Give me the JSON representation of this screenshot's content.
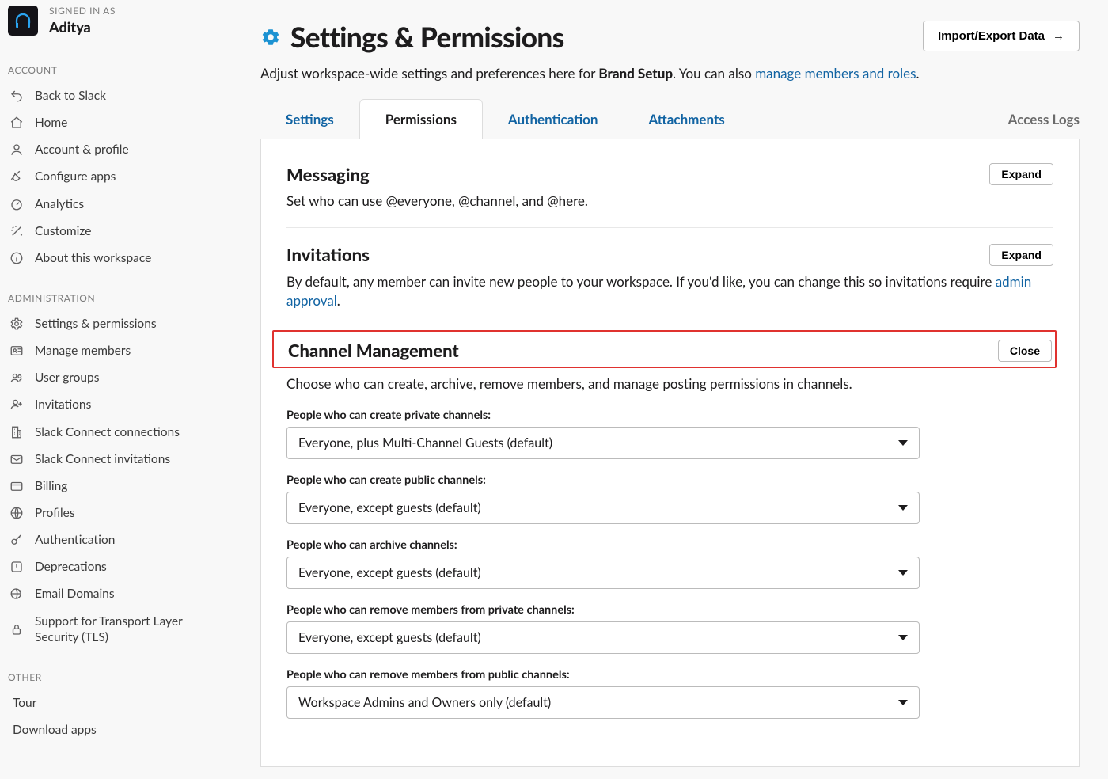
{
  "user": {
    "signed_in_as_label": "SIGNED IN AS",
    "name": "Aditya"
  },
  "sidebar": {
    "section_account": "ACCOUNT",
    "section_admin": "ADMINISTRATION",
    "section_other": "OTHER",
    "account_items": [
      {
        "id": "back",
        "label": "Back to Slack",
        "icon": "undo-icon"
      },
      {
        "id": "home",
        "label": "Home",
        "icon": "home-icon"
      },
      {
        "id": "profile",
        "label": "Account & profile",
        "icon": "person-icon"
      },
      {
        "id": "configure-apps",
        "label": "Configure apps",
        "icon": "plug-icon"
      },
      {
        "id": "analytics",
        "label": "Analytics",
        "icon": "gauge-icon"
      },
      {
        "id": "customize",
        "label": "Customize",
        "icon": "wand-icon"
      },
      {
        "id": "about",
        "label": "About this workspace",
        "icon": "info-icon"
      }
    ],
    "admin_items": [
      {
        "id": "settings-permissions",
        "label": "Settings & permissions",
        "icon": "gear-icon"
      },
      {
        "id": "manage-members",
        "label": "Manage members",
        "icon": "contact-card-icon"
      },
      {
        "id": "user-groups",
        "label": "User groups",
        "icon": "group-icon"
      },
      {
        "id": "invitations",
        "label": "Invitations",
        "icon": "person-plus-icon"
      },
      {
        "id": "slack-connect-connections",
        "label": "Slack Connect connections",
        "icon": "building-icon"
      },
      {
        "id": "slack-connect-invitations",
        "label": "Slack Connect invitations",
        "icon": "envelope-icon"
      },
      {
        "id": "billing",
        "label": "Billing",
        "icon": "card-icon"
      },
      {
        "id": "profiles",
        "label": "Profiles",
        "icon": "globe-icon"
      },
      {
        "id": "authentication",
        "label": "Authentication",
        "icon": "key-icon"
      },
      {
        "id": "deprecations",
        "label": "Deprecations",
        "icon": "warning-icon"
      },
      {
        "id": "email-domains",
        "label": "Email Domains",
        "icon": "globe-plus-icon"
      },
      {
        "id": "tls",
        "label": "Support for Transport Layer Security (TLS)",
        "icon": "lock-icon"
      }
    ],
    "other_items": [
      {
        "id": "tour",
        "label": "Tour"
      },
      {
        "id": "download",
        "label": "Download apps"
      }
    ]
  },
  "page": {
    "title": "Settings & Permissions",
    "import_button": "Import/Export Data",
    "subhead_pre": "Adjust workspace-wide settings and preferences here for ",
    "workspace_name": "Brand Setup",
    "subhead_post": ". You can also ",
    "manage_link": "manage members and roles",
    "subhead_end": "."
  },
  "tabs": {
    "settings": "Settings",
    "permissions": "Permissions",
    "authentication": "Authentication",
    "attachments": "Attachments",
    "access_logs": "Access Logs"
  },
  "sections": {
    "messaging": {
      "title": "Messaging",
      "desc": "Set who can use @everyone, @channel, and @here.",
      "action": "Expand"
    },
    "invitations": {
      "title": "Invitations",
      "desc_pre": "By default, any member can invite new people to your workspace. If you'd like, you can change this so invitations require ",
      "link": "admin approval",
      "desc_post": ".",
      "action": "Expand"
    },
    "channel_management": {
      "title": "Channel Management",
      "desc": "Choose who can create, archive, remove members, and manage posting permissions in channels.",
      "action": "Close",
      "fields": [
        {
          "label": "People who can create private channels:",
          "value": "Everyone, plus Multi-Channel Guests (default)"
        },
        {
          "label": "People who can create public channels:",
          "value": "Everyone, except guests (default)"
        },
        {
          "label": "People who can archive channels:",
          "value": "Everyone, except guests (default)"
        },
        {
          "label": "People who can remove members from private channels:",
          "value": "Everyone, except guests (default)"
        },
        {
          "label": "People who can remove members from public channels:",
          "value": "Workspace Admins and Owners only (default)"
        }
      ]
    }
  }
}
